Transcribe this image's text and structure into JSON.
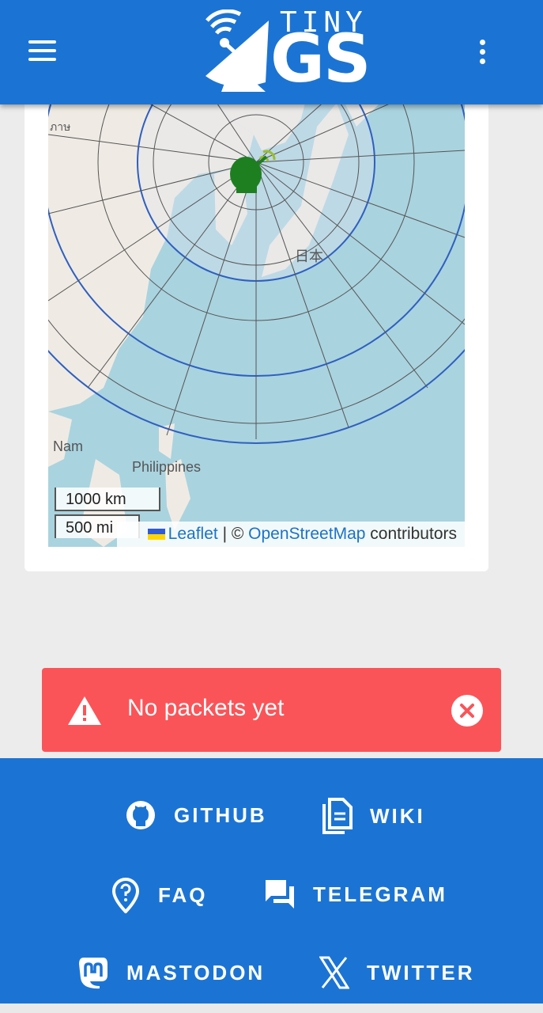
{
  "header": {
    "logo_tiny": "TINY",
    "logo_gs": "GS",
    "menu_icon": "hamburger-menu-icon",
    "more_icon": "more-vertical-icon"
  },
  "map": {
    "labels": {
      "japan": "日本",
      "nam": "Nam",
      "philippines": "Philippines",
      "top_left": "ภาษ"
    },
    "scale_km": "1000 km",
    "scale_mi": "500 mi",
    "attribution": {
      "leaflet": "Leaflet",
      "separator": " | © ",
      "osm": "OpenStreetMap",
      "contributors": " contributors"
    }
  },
  "alert": {
    "text": "No packets yet",
    "icon": "warning-icon",
    "close_icon": "close-circle-icon",
    "color": "#fb5458"
  },
  "footer": {
    "links": [
      {
        "label": "GITHUB",
        "icon": "github-icon"
      },
      {
        "label": "WIKI",
        "icon": "document-icon"
      },
      {
        "label": "FAQ",
        "icon": "location-question-icon"
      },
      {
        "label": "TELEGRAM",
        "icon": "chat-icon"
      },
      {
        "label": "MASTODON",
        "icon": "mastodon-icon"
      },
      {
        "label": "TWITTER",
        "icon": "x-icon"
      }
    ]
  },
  "colors": {
    "primary": "#1b74d4",
    "background": "#ececec"
  }
}
